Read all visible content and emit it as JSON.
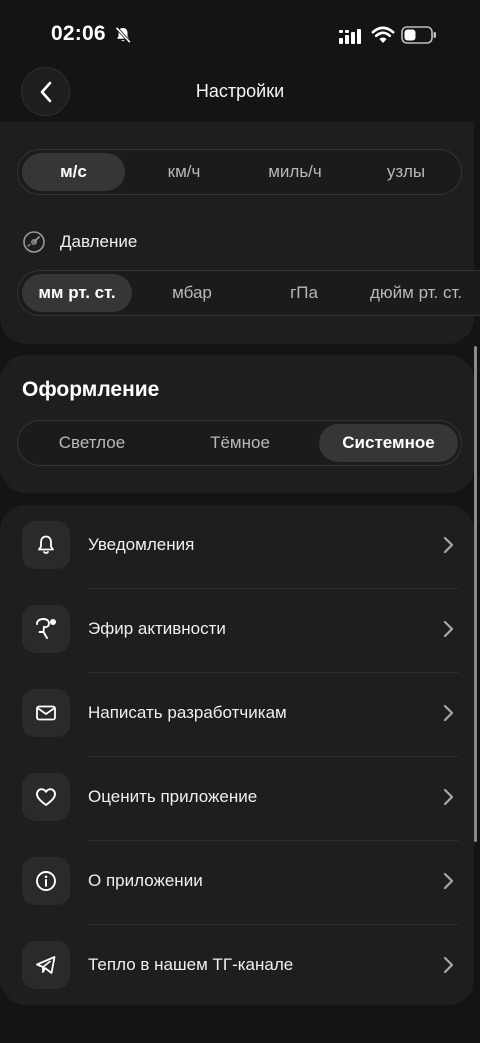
{
  "status_bar": {
    "time": "02:06"
  },
  "header": {
    "title": "Настройки"
  },
  "wind_units": {
    "options": [
      "м/с",
      "км/ч",
      "миль/ч",
      "узлы"
    ],
    "selected": "м/с"
  },
  "pressure": {
    "label": "Давление",
    "options": [
      "мм рт. ст.",
      "мбар",
      "гПа",
      "дюйм рт. ст."
    ],
    "selected": "мм рт. ст."
  },
  "theme": {
    "title": "Оформление",
    "options": [
      "Светлое",
      "Тёмное",
      "Системное"
    ],
    "selected": "Системное"
  },
  "menu": {
    "items": [
      {
        "label": "Уведомления",
        "icon": "bell-icon"
      },
      {
        "label": "Эфир активности",
        "icon": "activity-broadcast-icon"
      },
      {
        "label": "Написать разработчикам",
        "icon": "mail-icon"
      },
      {
        "label": "Оценить приложение",
        "icon": "heart-icon"
      },
      {
        "label": "О приложении",
        "icon": "info-icon"
      },
      {
        "label": "Тепло в нашем ТГ-канале",
        "icon": "telegram-icon"
      }
    ]
  },
  "colors": {
    "background": "#141414",
    "card": "#1e1e1e",
    "segment_active": "#363636",
    "text": "#f2f2f2"
  }
}
